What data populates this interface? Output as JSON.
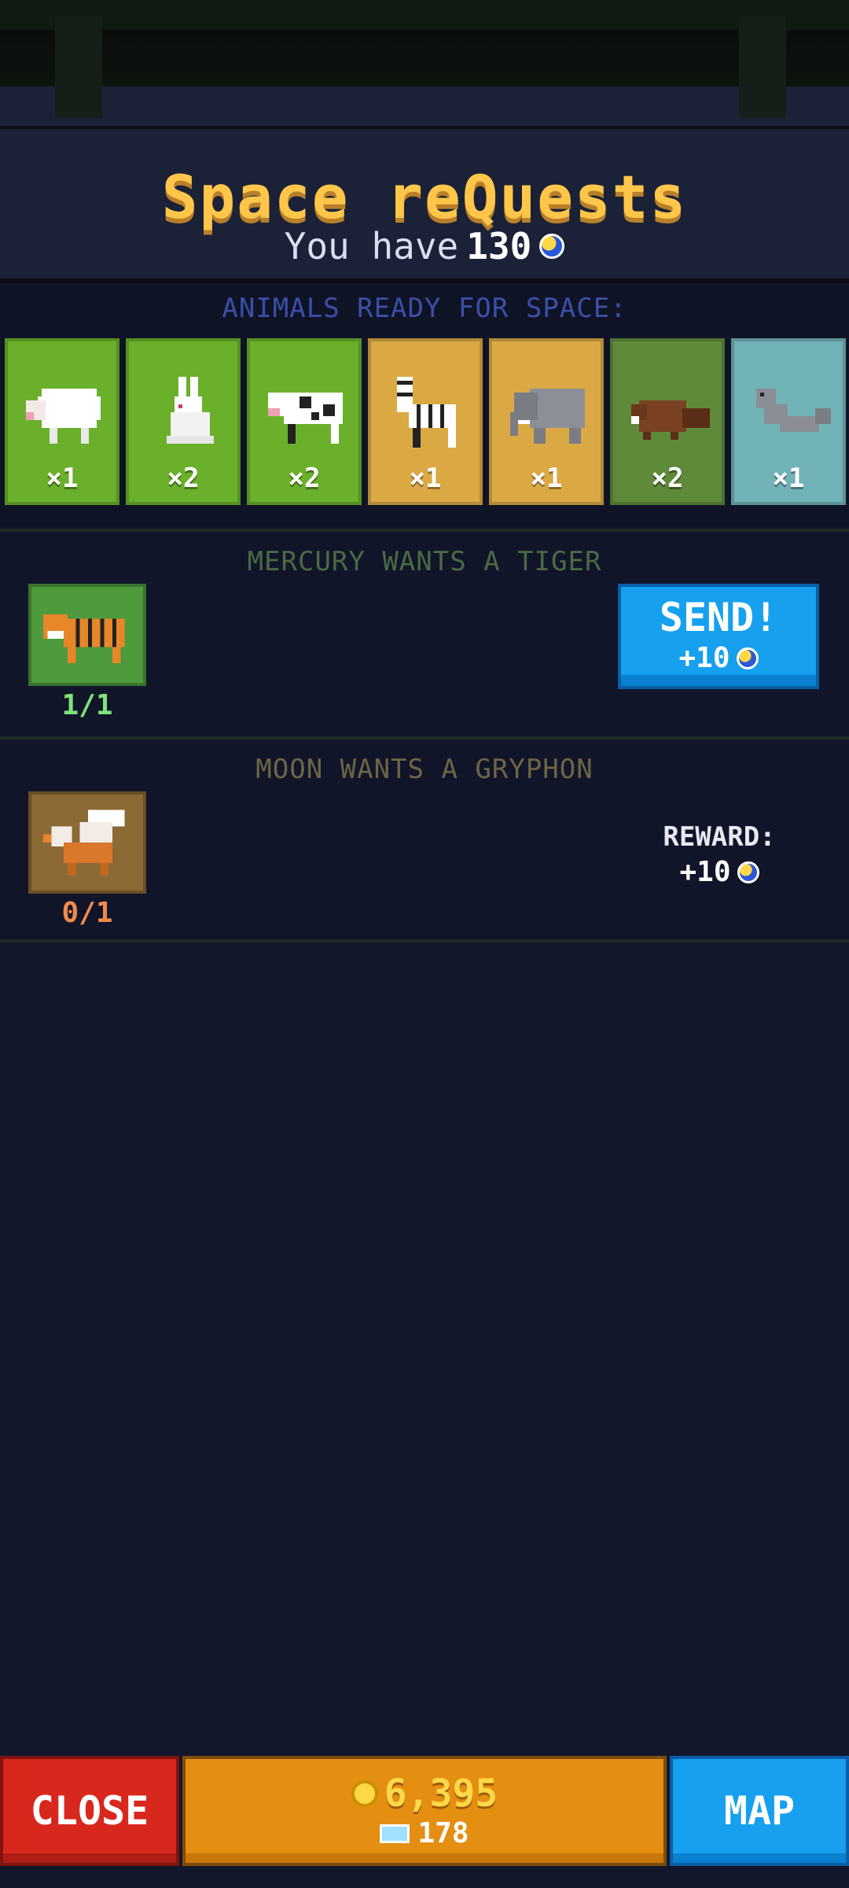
{
  "header": {
    "title": "Space reQuests",
    "subtitle_prefix": "You have",
    "moon_balance": "130"
  },
  "animals": {
    "heading": "ANIMALS READY FOR SPACE:",
    "items": [
      {
        "name": "sheep",
        "count": "×1",
        "habitat": "grassland"
      },
      {
        "name": "rabbit",
        "count": "×2",
        "habitat": "grassland"
      },
      {
        "name": "cow",
        "count": "×2",
        "habitat": "grassland"
      },
      {
        "name": "zebra",
        "count": "×1",
        "habitat": "savanna"
      },
      {
        "name": "elephant",
        "count": "×1",
        "habitat": "savanna"
      },
      {
        "name": "beaver",
        "count": "×2",
        "habitat": "forest"
      },
      {
        "name": "seal",
        "count": "×1",
        "habitat": "water"
      }
    ]
  },
  "requests": [
    {
      "heading": "MERCURY WANTS A TIGER",
      "animal": "tiger",
      "progress": "1/1",
      "progress_color": "#7ee37a",
      "button_label": "SEND!",
      "reward": "+10"
    },
    {
      "heading": "MOON WANTS A GRYPHON",
      "animal": "gryphon",
      "progress": "0/1",
      "progress_color": "#f08a4a",
      "reward_label": "REWARD:",
      "reward": "+10"
    }
  ],
  "bottom_bar": {
    "close_label": "CLOSE",
    "coins": "6,395",
    "tickets": "178",
    "map_label": "MAP"
  },
  "colors": {
    "title": "#ffc64a",
    "send_button": "#16a0ee",
    "close_button": "#d8281e",
    "currency_panel": "#e48e12"
  }
}
